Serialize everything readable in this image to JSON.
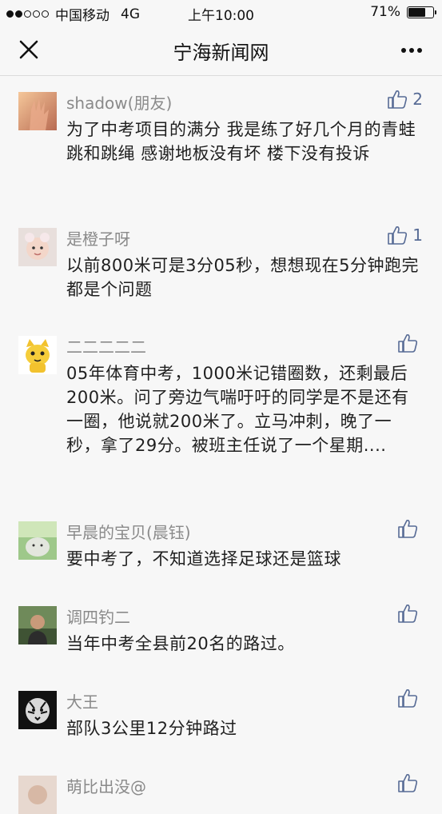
{
  "status_bar": {
    "carrier": "中国移动",
    "network": "4G",
    "time": "上午10:00",
    "battery_percent": "71%",
    "battery_level": 0.71,
    "signal_bars": 2
  },
  "nav": {
    "title": "宁海新闻网",
    "close_icon": "close-icon",
    "more_icon": "more-icon"
  },
  "colors": {
    "like_blue": "#576b95",
    "nickname_gray": "#8a8a8a",
    "background": "#f7f7f7"
  },
  "comments": [
    {
      "nickname": "shadow(朋友)",
      "likes": "2",
      "text": "为了中考项目的满分 我是练了好几个月的青蛙跳和跳绳 感谢地板没有坏 楼下没有投诉"
    },
    {
      "nickname": "是橙子呀",
      "likes": "1",
      "text": "以前800米可是3分05秒，想想现在5分钟跑完都是个问题"
    },
    {
      "nickname": "二二二二二",
      "likes": "",
      "text": "05年体育中考，1000米记错圈数，还剩最后200米。问了旁边气喘吁吁的同学是不是还有一圈，他说就200米了。立马冲刺，晚了一秒，拿了29分。被班主任说了一个星期...."
    },
    {
      "nickname": "早晨的宝贝(晨钰)",
      "likes": "",
      "text": "要中考了，不知道选择足球还是篮球"
    },
    {
      "nickname": "调四钓二",
      "likes": "",
      "text": "当年中考全县前20名的路过。"
    },
    {
      "nickname": "大王",
      "likes": "",
      "text": "部队3公里12分钟路过"
    },
    {
      "nickname": "萌比出没@",
      "likes": "",
      "text": ""
    }
  ]
}
